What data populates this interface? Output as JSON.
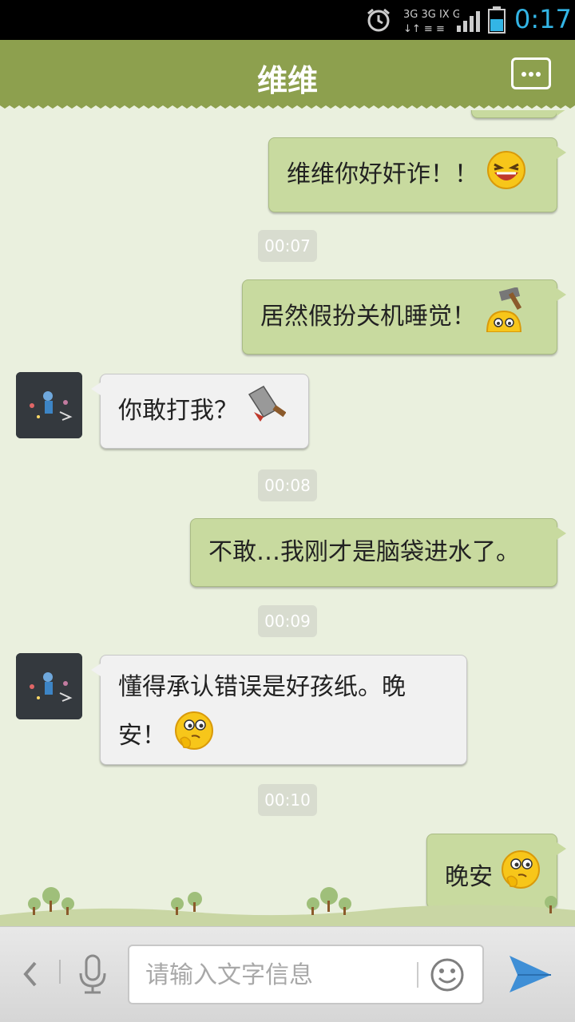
{
  "status_bar": {
    "network": "3G 3G IX G",
    "time": "0:17"
  },
  "header": {
    "title": "维维",
    "menu_icon": "more-icon"
  },
  "messages": [
    {
      "type": "out",
      "text": "维维你好奸诈！！",
      "emoji": "laughing-emoji"
    },
    {
      "type": "time",
      "text": "00:07"
    },
    {
      "type": "out",
      "text": "居然假扮关机睡觉！",
      "emoji": "hammer-head-emoji"
    },
    {
      "type": "in",
      "text": "你敢打我？",
      "emoji": "cleaver-emoji"
    },
    {
      "type": "time",
      "text": "00:08"
    },
    {
      "type": "out",
      "text": "不敢…我刚才是脑袋进水了。"
    },
    {
      "type": "time",
      "text": "00:09"
    },
    {
      "type": "in",
      "text_line1": "懂得承认错误是好孩纸。晚",
      "text_line2": "安！",
      "emoji": "thinking-emoji"
    },
    {
      "type": "time",
      "text": "00:10"
    },
    {
      "type": "out",
      "text": "晚安",
      "emoji": "thinking-emoji"
    }
  ],
  "input_bar": {
    "placeholder": "请输入文字信息",
    "back_icon": "chevron-left-icon",
    "voice_icon": "microphone-icon",
    "emoji_icon": "smiley-icon",
    "send_icon": "send-icon"
  },
  "colors": {
    "header": "#8da04e",
    "background": "#eaf0de",
    "outgoing_bubble": "#c8da9f",
    "incoming_bubble": "#f1f1f1",
    "clock": "#33b5e5"
  }
}
